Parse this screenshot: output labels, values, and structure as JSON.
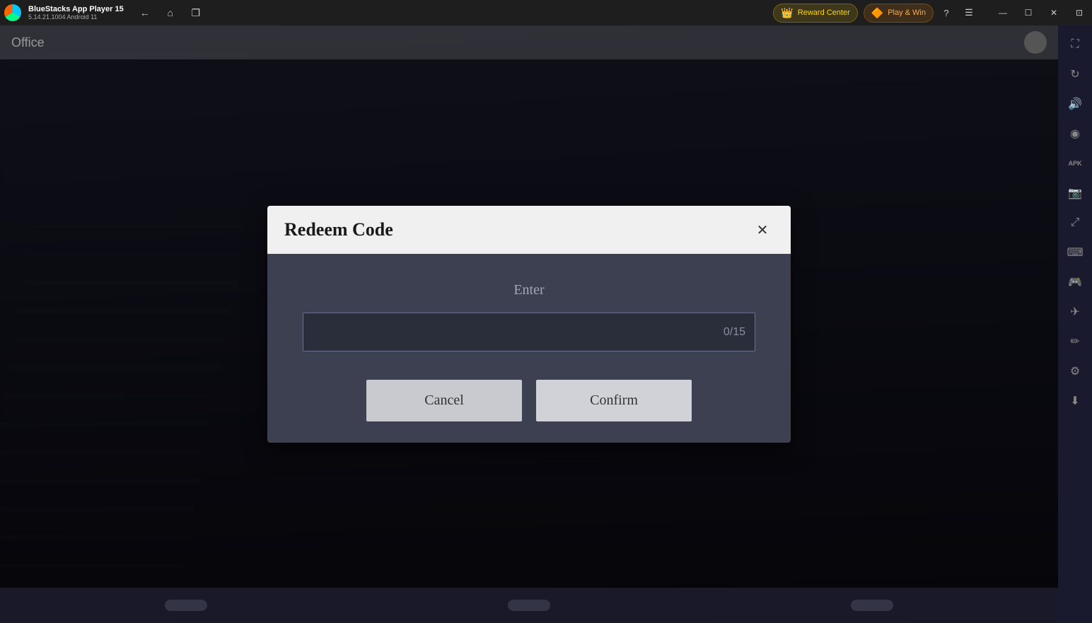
{
  "titlebar": {
    "app_name": "BlueStacks App Player 15",
    "app_version": "5.14.21.1004  Android 11",
    "reward_center_label": "Reward Center",
    "play_win_label": "Play & Win"
  },
  "nav": {
    "back_label": "←",
    "home_label": "⌂",
    "copy_label": "❐"
  },
  "window_controls": {
    "minimize": "—",
    "maximize": "☐",
    "close": "✕",
    "restore": "⊡"
  },
  "sidebar": {
    "icons": [
      {
        "name": "expand-icon",
        "symbol": "⛶"
      },
      {
        "name": "rotate-icon",
        "symbol": "↻"
      },
      {
        "name": "volume-icon",
        "symbol": "🔊"
      },
      {
        "name": "screenshot-icon",
        "symbol": "📷"
      },
      {
        "name": "apk-icon",
        "symbol": "APK"
      },
      {
        "name": "camera-icon",
        "symbol": "📸"
      },
      {
        "name": "fullscreen-icon",
        "symbol": "⛶"
      },
      {
        "name": "keyboard-icon",
        "symbol": "⌨"
      },
      {
        "name": "gamepad-icon",
        "symbol": "🎮"
      },
      {
        "name": "location-icon",
        "symbol": "✈"
      },
      {
        "name": "eraser-icon",
        "symbol": "✏"
      },
      {
        "name": "settings-icon",
        "symbol": "⚙"
      },
      {
        "name": "download-icon",
        "symbol": "⬇"
      }
    ]
  },
  "game": {
    "topbar_title": "Office",
    "bottombar_btn1": "btnLeft",
    "bottombar_btn2": "btnMid",
    "bottombar_btn3": "btnRight"
  },
  "dialog": {
    "title": "Redeem Code",
    "enter_label": "Enter",
    "input_value": "",
    "input_placeholder": "",
    "char_count": "0/15",
    "cancel_label": "Cancel",
    "confirm_label": "Confirm",
    "close_symbol": "✕"
  }
}
